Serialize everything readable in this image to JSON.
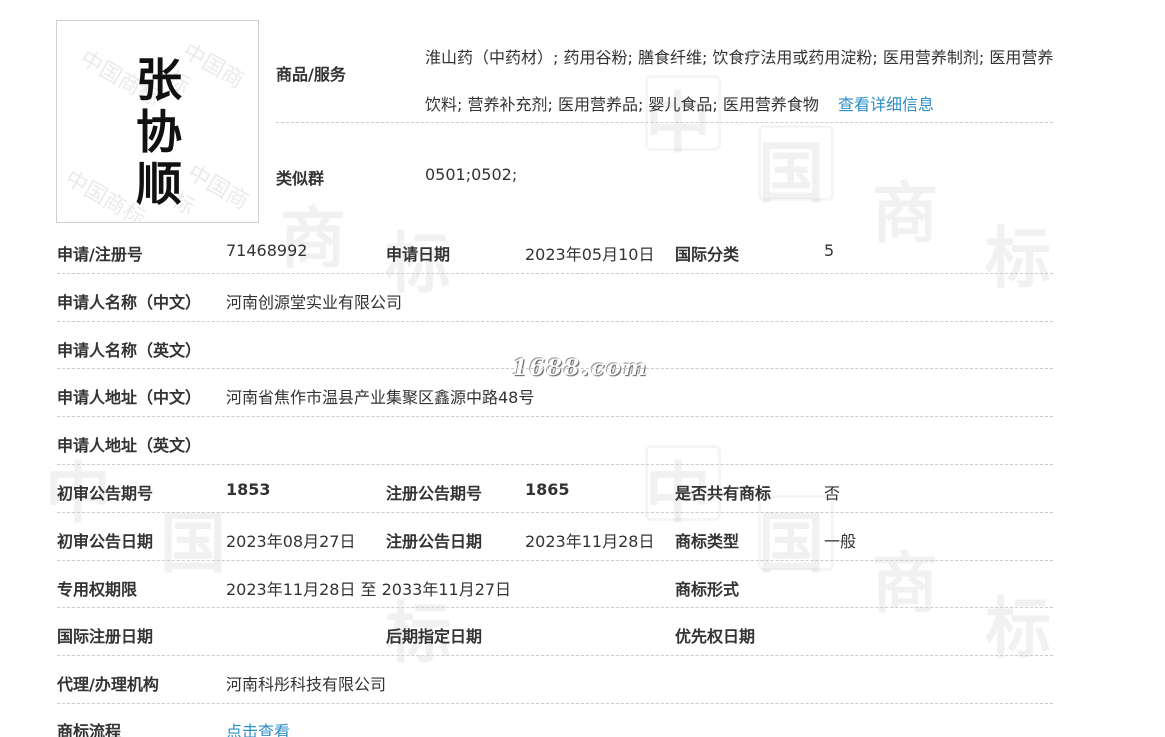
{
  "logo": {
    "chars": [
      "张",
      "协",
      "顺"
    ],
    "watermark_text": "中国商标"
  },
  "page_watermark": {
    "chars": [
      "中",
      "国",
      "商",
      "标"
    ],
    "site_text": "1688.com"
  },
  "goods_services": {
    "label": "商品/服务",
    "text": "淮山药（中药材）; 药用谷粉; 膳食纤维; 饮食疗法用或药用淀粉; 医用营养制剂; 医用营养饮料; 营养补充剂; 医用营养品; 婴儿食品; 医用营养食物",
    "link_text": "查看详细信息"
  },
  "similar_group": {
    "label": "类似群",
    "value": "0501;0502;"
  },
  "rows": {
    "app_no": {
      "label": "申请/注册号",
      "value": "71468992"
    },
    "app_date": {
      "label": "申请日期",
      "value": "2023年05月10日"
    },
    "intl_class": {
      "label": "国际分类",
      "value": "5"
    },
    "applicant_cn": {
      "label": "申请人名称（中文）",
      "value": "河南创源堂实业有限公司"
    },
    "applicant_en": {
      "label": "申请人名称（英文）",
      "value": ""
    },
    "address_cn": {
      "label": "申请人地址（中文）",
      "value": "河南省焦作市温县产业集聚区鑫源中路48号"
    },
    "address_en": {
      "label": "申请人地址（英文）",
      "value": ""
    },
    "prelim_no": {
      "label": "初审公告期号",
      "value": "1853"
    },
    "reg_no": {
      "label": "注册公告期号",
      "value": "1865"
    },
    "shared": {
      "label": "是否共有商标",
      "value": "否"
    },
    "prelim_date": {
      "label": "初审公告日期",
      "value": "2023年08月27日"
    },
    "reg_date": {
      "label": "注册公告日期",
      "value": "2023年11月28日"
    },
    "tm_type": {
      "label": "商标类型",
      "value": "一般"
    },
    "excl_period": {
      "label": "专用权期限",
      "value": "2023年11月28日 至 2033年11月27日"
    },
    "tm_form": {
      "label": "商标形式",
      "value": ""
    },
    "intl_reg": {
      "label": "国际注册日期",
      "value": ""
    },
    "later_date": {
      "label": "后期指定日期",
      "value": ""
    },
    "priority": {
      "label": "优先权日期",
      "value": ""
    },
    "agent": {
      "label": "代理/办理机构",
      "value": "河南科彤科技有限公司"
    },
    "process": {
      "label": "商标流程",
      "link_text": "点击查看"
    }
  }
}
